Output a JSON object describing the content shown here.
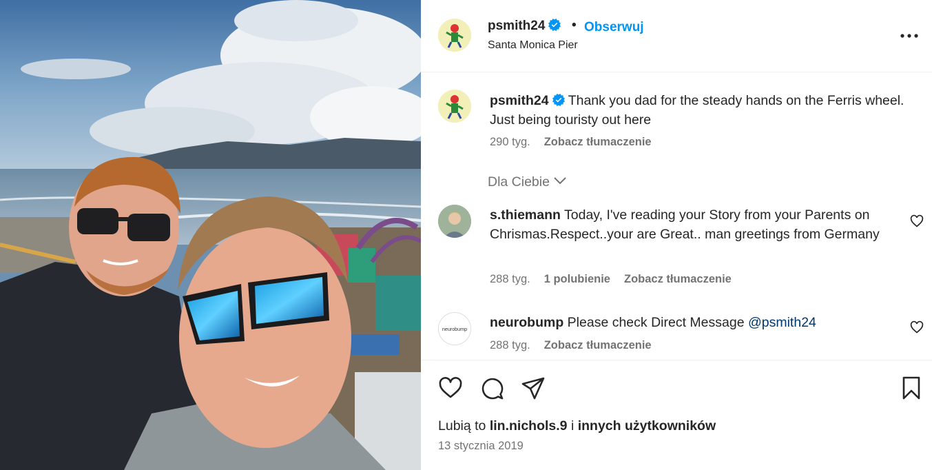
{
  "post": {
    "username": "psmith24",
    "follow_label": "Obserwuj",
    "separator": "•",
    "location": "Santa Monica Pier"
  },
  "caption": {
    "username": "psmith24",
    "text": "Thank you dad for the steady hands on the Ferris wheel. Just being touristy out here",
    "age": "290 tyg.",
    "translate_label": "Zobacz tłumaczenie"
  },
  "comments_filter": {
    "label": "Dla Ciebie"
  },
  "comments": [
    {
      "username": "s.thiemann",
      "text": "Today, I've reading your Story from your Parents on Chrismas.Respect..your are Great.. man greetings from Germany",
      "age": "288 tyg.",
      "likes_label": "1 polubienie",
      "translate_label": "Zobacz tłumaczenie"
    },
    {
      "username": "neurobump",
      "text": "Please check Direct Message",
      "mention": "@psmith24",
      "age": "288 tyg.",
      "translate_label": "Zobacz tłumaczenie",
      "avatar_text": "neurobump"
    }
  ],
  "likes": {
    "prefix": "Lubią to",
    "user": "lin.nichols.9",
    "connector": "i",
    "others": "innych użytkowników"
  },
  "date": "13 stycznia 2019",
  "colors": {
    "accent_blue": "#0095f6",
    "verified_blue": "#0095f6",
    "text_primary": "#262626",
    "text_secondary": "#737373",
    "mention": "#00376b"
  },
  "icons": {
    "verified": "verified-badge-icon",
    "more": "more-options-icon",
    "like": "heart-icon",
    "comment": "comment-icon",
    "share": "share-icon",
    "save": "bookmark-icon",
    "chevron": "chevron-down-icon"
  }
}
